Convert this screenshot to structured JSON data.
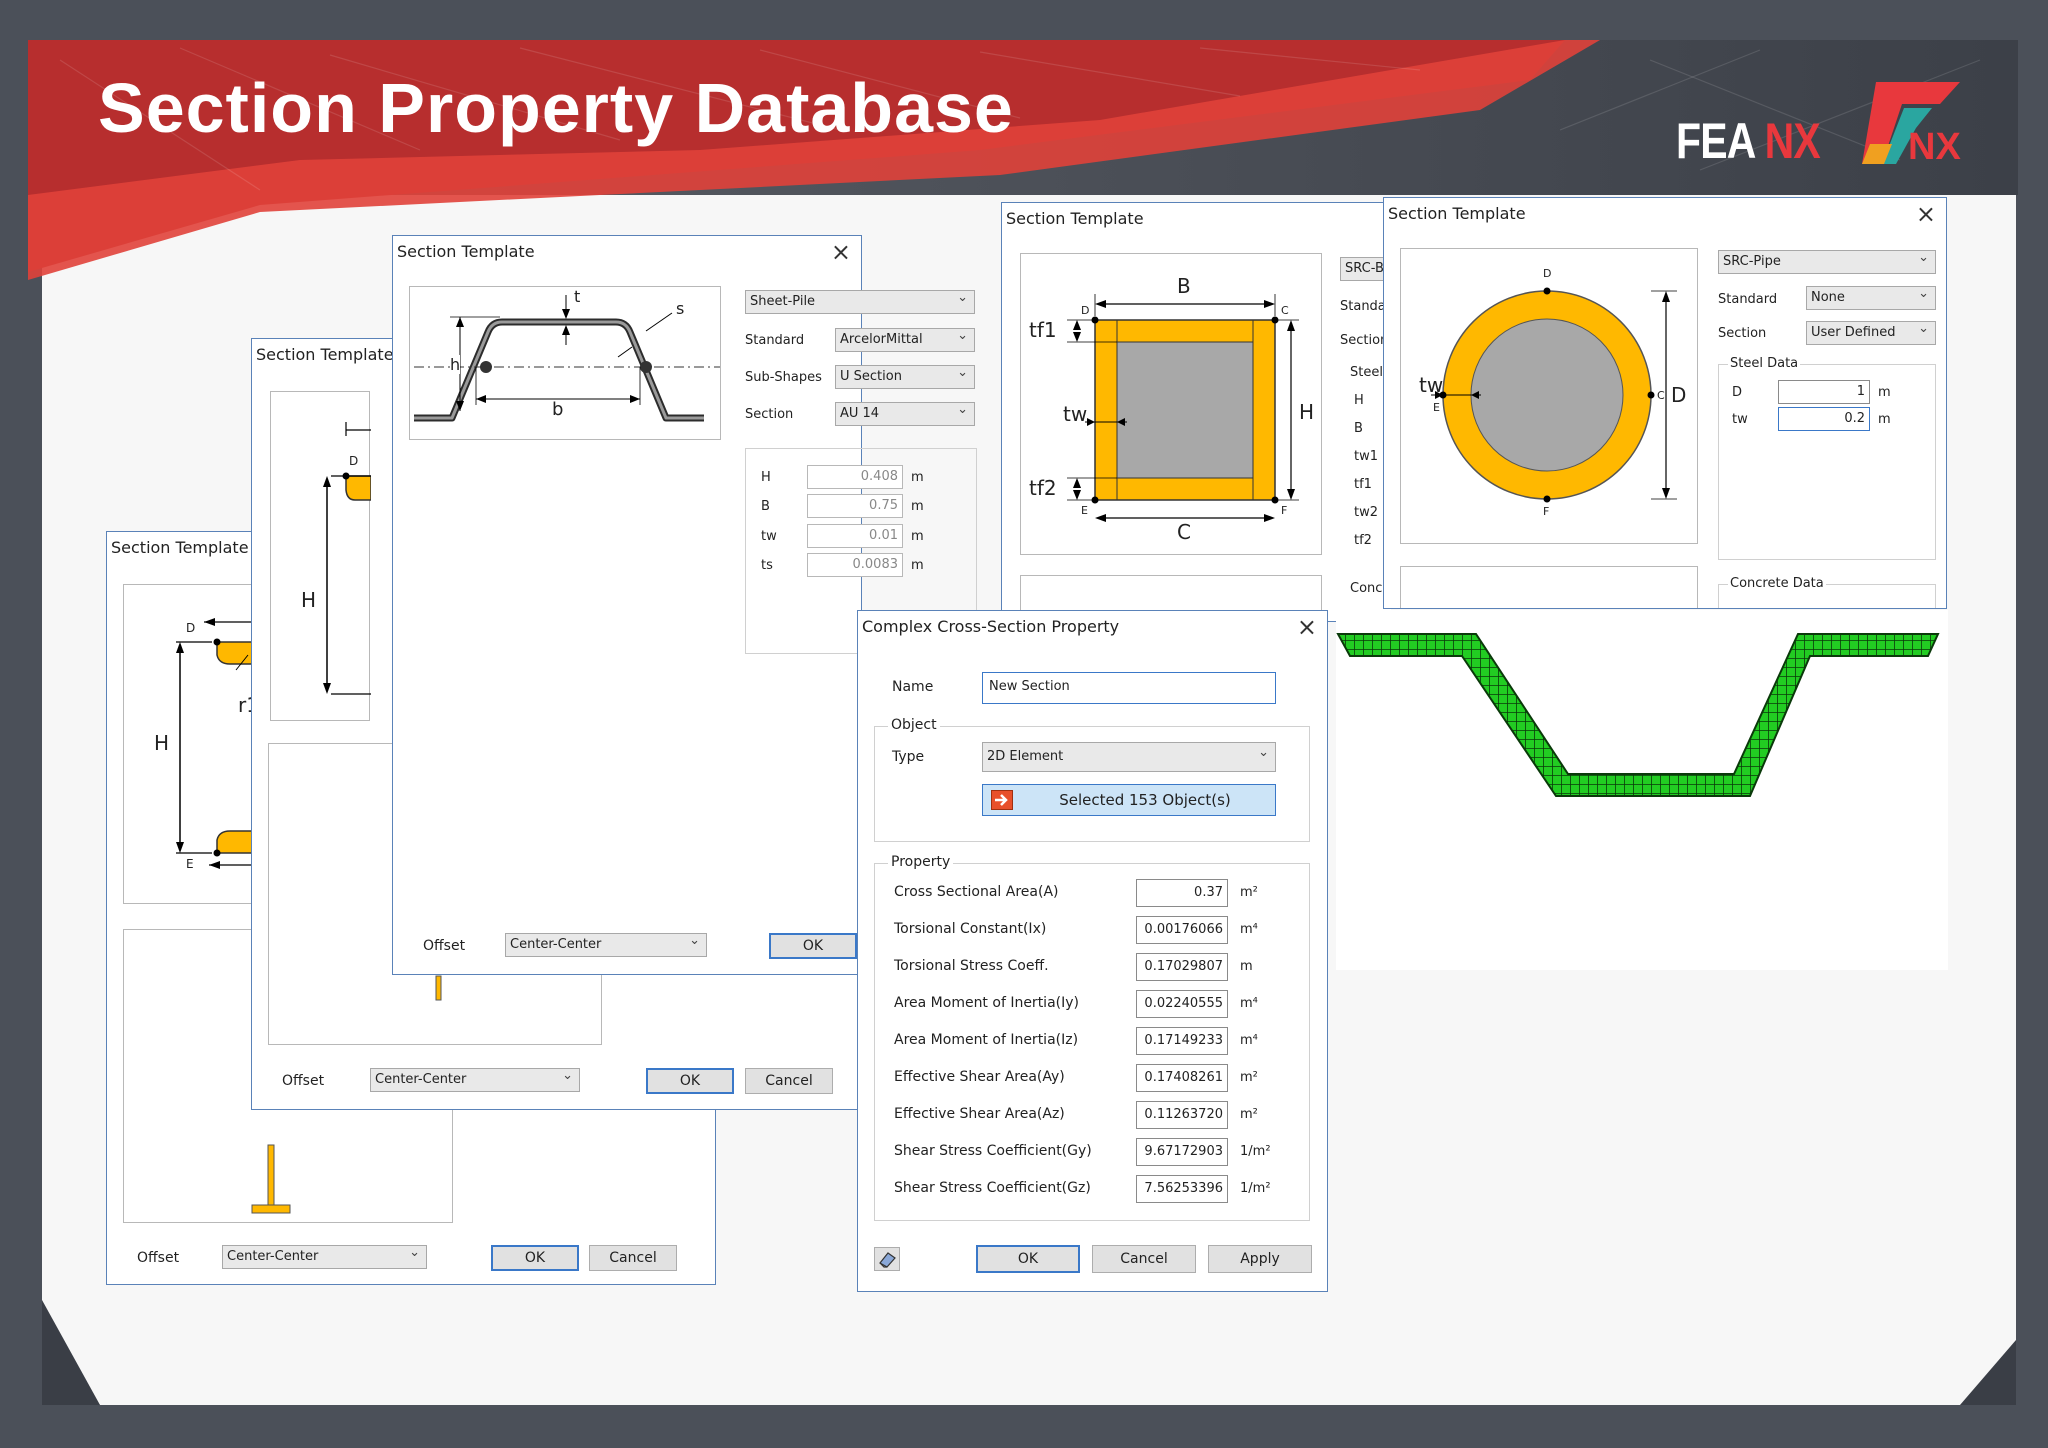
{
  "slide": {
    "title": "Section Property Database",
    "brand_text": "FEA",
    "brand_accent": "NX",
    "logo_text": "NX",
    "colors": {
      "banner_red": "#c8332e",
      "brand_red": "#e8383d",
      "section_fill": "#ffb800",
      "mesh_green": "#22cc22"
    }
  },
  "win_sheetpile": {
    "title": "Section Template",
    "shape": "Sheet-Pile",
    "standard_label": "Standard",
    "standard_value": "ArcelorMittal",
    "subshapes_label": "Sub-Shapes",
    "subshapes_value": "U Section",
    "section_label": "Section",
    "section_value": "AU 14",
    "fields": [
      {
        "label": "H",
        "value": "0.408",
        "unit": "m"
      },
      {
        "label": "B",
        "value": "0.75",
        "unit": "m"
      },
      {
        "label": "tw",
        "value": "0.01",
        "unit": "m"
      },
      {
        "label": "ts",
        "value": "0.0083",
        "unit": "m"
      }
    ],
    "offset_label": "Offset",
    "offset_value": "Center-Center",
    "ok_label": "OK",
    "diagram_labels": {
      "t": "t",
      "s": "s",
      "h": "h",
      "b": "b"
    }
  },
  "win_mid": {
    "title": "Section Template",
    "offset_label": "Offset",
    "offset_value": "Center-Center",
    "ok_label": "OK",
    "cancel_label": "Cancel",
    "diagram_labels": {
      "d": "D",
      "h": "H"
    }
  },
  "win_back": {
    "title": "Section Template",
    "offset_label": "Offset",
    "offset_value": "Center-Center",
    "ok_label": "OK",
    "cancel_label": "Cancel",
    "diagram_labels": {
      "d": "D",
      "e": "E",
      "h": "H",
      "r1": "r1"
    }
  },
  "win_box": {
    "title": "Section Template",
    "shape_partial": "SRC-B",
    "standard_partial": "Standa",
    "section_partial": "Section",
    "steel_partial": "Steel",
    "concrete_partial": "Conc",
    "fields": [
      "H",
      "B",
      "tw1",
      "tf1",
      "tw2",
      "tf2"
    ],
    "diagram_labels": {
      "b": "B",
      "c": "C",
      "h": "H",
      "tf1": "tf1",
      "tf2": "tf2",
      "tw": "tw",
      "d": "D",
      "cc": "C",
      "e": "E",
      "f": "F"
    }
  },
  "win_pipe": {
    "title": "Section Template",
    "shape": "SRC-Pipe",
    "standard_label": "Standard",
    "standard_value": "None",
    "section_label": "Section",
    "section_value": "User Defined",
    "steel_label": "Steel Data",
    "fields": [
      {
        "label": "D",
        "value": "1",
        "unit": "m"
      },
      {
        "label": "tw",
        "value": "0.2",
        "unit": "m"
      }
    ],
    "concrete_label": "Concrete Data",
    "diagram_labels": {
      "d_top": "D",
      "d_dim": "D",
      "c": "C",
      "tw": "tw",
      "e": "E",
      "f": "F"
    }
  },
  "win_complex": {
    "title": "Complex Cross-Section Property",
    "name_label": "Name",
    "name_value": "New Section",
    "object_label": "Object",
    "type_label": "Type",
    "type_value": "2D Element",
    "selected_label": "Selected 153 Object(s)",
    "property_label": "Property",
    "properties": [
      {
        "label": "Cross Sectional Area(A)",
        "value": "0.37",
        "unit": "m²"
      },
      {
        "label": "Torsional Constant(Ix)",
        "value": "0.00176066",
        "unit": "m⁴"
      },
      {
        "label": "Torsional Stress Coeff.",
        "value": "0.17029807",
        "unit": "m"
      },
      {
        "label": "Area Moment of Inertia(Iy)",
        "value": "0.02240555",
        "unit": "m⁴"
      },
      {
        "label": "Area Moment of Inertia(Iz)",
        "value": "0.17149233",
        "unit": "m⁴"
      },
      {
        "label": "Effective Shear Area(Ay)",
        "value": "0.17408261",
        "unit": "m²"
      },
      {
        "label": "Effective Shear Area(Az)",
        "value": "0.11263720",
        "unit": "m²"
      },
      {
        "label": "Shear Stress Coefficient(Gy)",
        "value": "9.67172903",
        "unit": "1/m²"
      },
      {
        "label": "Shear Stress Coefficient(Gz)",
        "value": "7.56253396",
        "unit": "1/m²"
      }
    ],
    "ok_label": "OK",
    "cancel_label": "Cancel",
    "apply_label": "Apply"
  }
}
